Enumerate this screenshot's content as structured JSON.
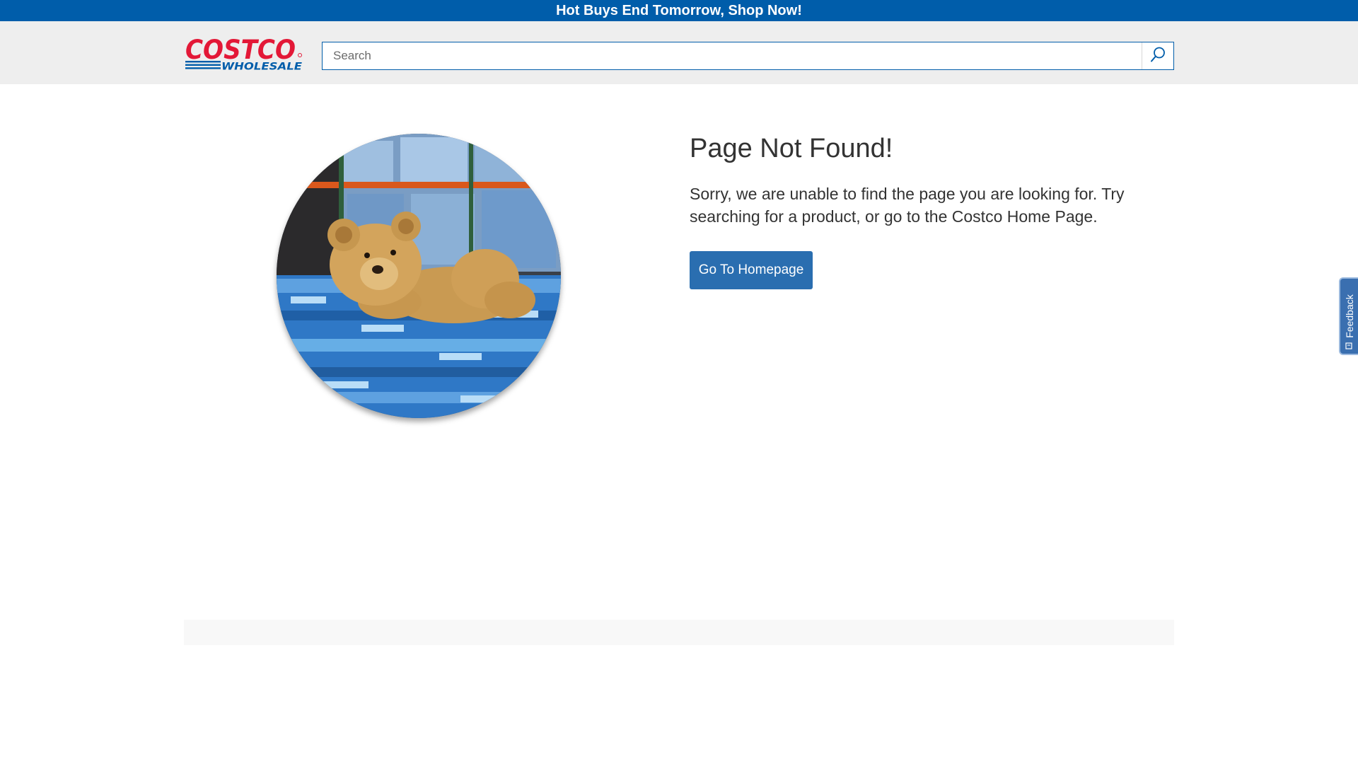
{
  "promo_bar": {
    "text": "Hot Buys End Tomorrow, Shop Now!"
  },
  "header": {
    "logo": {
      "top_text": "COSTCO",
      "bottom_text": "WHOLESALE",
      "brand_red": "#e31837",
      "brand_blue": "#005daa"
    },
    "search": {
      "placeholder": "Search",
      "value": "",
      "icon": "search-icon"
    }
  },
  "main": {
    "image": {
      "subject": "teddy bear on water bottle pallets",
      "shape": "circle"
    },
    "title": "Page Not Found!",
    "message": "Sorry, we are unable to find the page you are looking for. Try searching for a product, or go to the Costco Home Page.",
    "home_button_label": "Go To Homepage"
  },
  "feedback_tab": {
    "label": "Feedback",
    "icon": "feedback-icon"
  },
  "colors": {
    "promo_background": "#005daa",
    "header_background": "#eeeeee",
    "button_background": "#2a6eb0",
    "text": "#333333"
  }
}
